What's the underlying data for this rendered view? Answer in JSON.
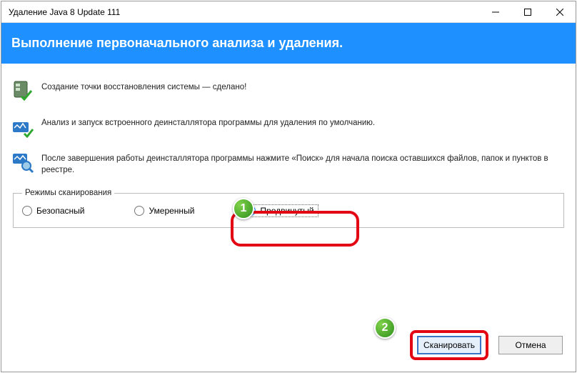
{
  "window": {
    "title": "Удаление Java 8 Update 111"
  },
  "banner": {
    "text": "Выполнение первоначального анализа и удаления."
  },
  "steps": {
    "s1": "Создание точки восстановления системы — сделано!",
    "s2": "Анализ и запуск встроенного деинсталлятора программы для удаления по умолчанию.",
    "s3": "После завершения работы деинсталлятора программы нажмите «Поиск» для начала поиска оставшихся файлов, папок и пунктов в реестре."
  },
  "group": {
    "legend": "Режимы сканирования",
    "options": {
      "safe": "Безопасный",
      "moderate": "Умеренный",
      "advanced": "Продвинутый"
    }
  },
  "buttons": {
    "scan": "Сканировать",
    "cancel": "Отмена"
  },
  "badges": {
    "one": "1",
    "two": "2"
  }
}
